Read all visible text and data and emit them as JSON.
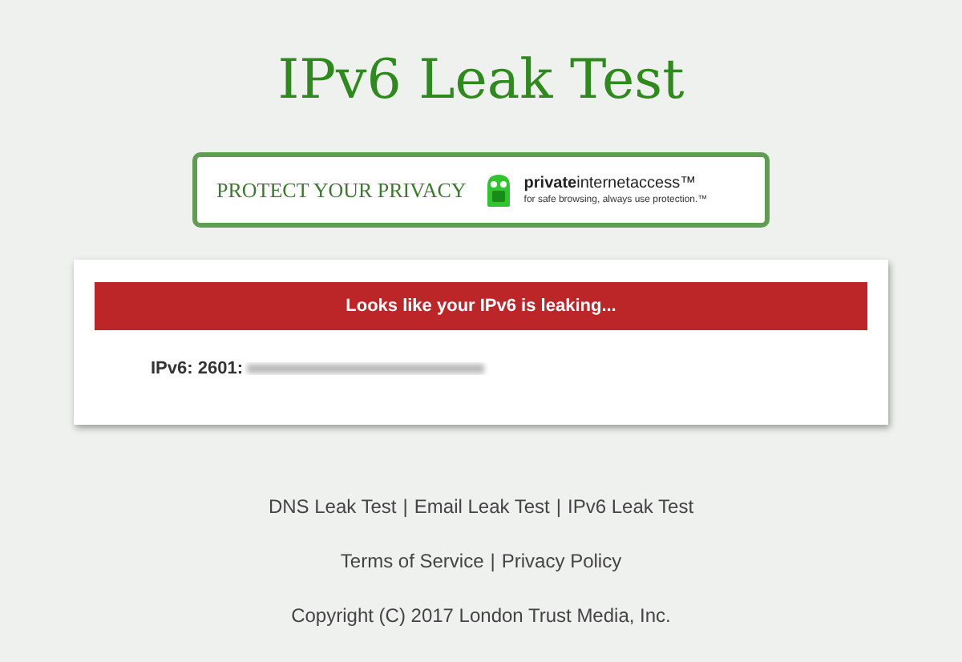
{
  "title": "IPv6 Leak Test",
  "banner": {
    "slogan": "PROTECT YOUR PRIVACY",
    "brand": "**private**internetaccess™",
    "tagline": "for safe browsing, always use protection.™"
  },
  "result": {
    "alert": "Looks like your IPv6 is leaking...",
    "address_label": "IPv6: 2601:"
  },
  "footer": {
    "links": [
      "DNS Leak Test",
      "Email Leak Test",
      "IPv6 Leak Test"
    ],
    "legal_links": [
      "Terms of Service",
      "Privacy Policy"
    ],
    "separator": "|",
    "copyright": "Copyright (C) 2017 London Trust Media, Inc."
  }
}
